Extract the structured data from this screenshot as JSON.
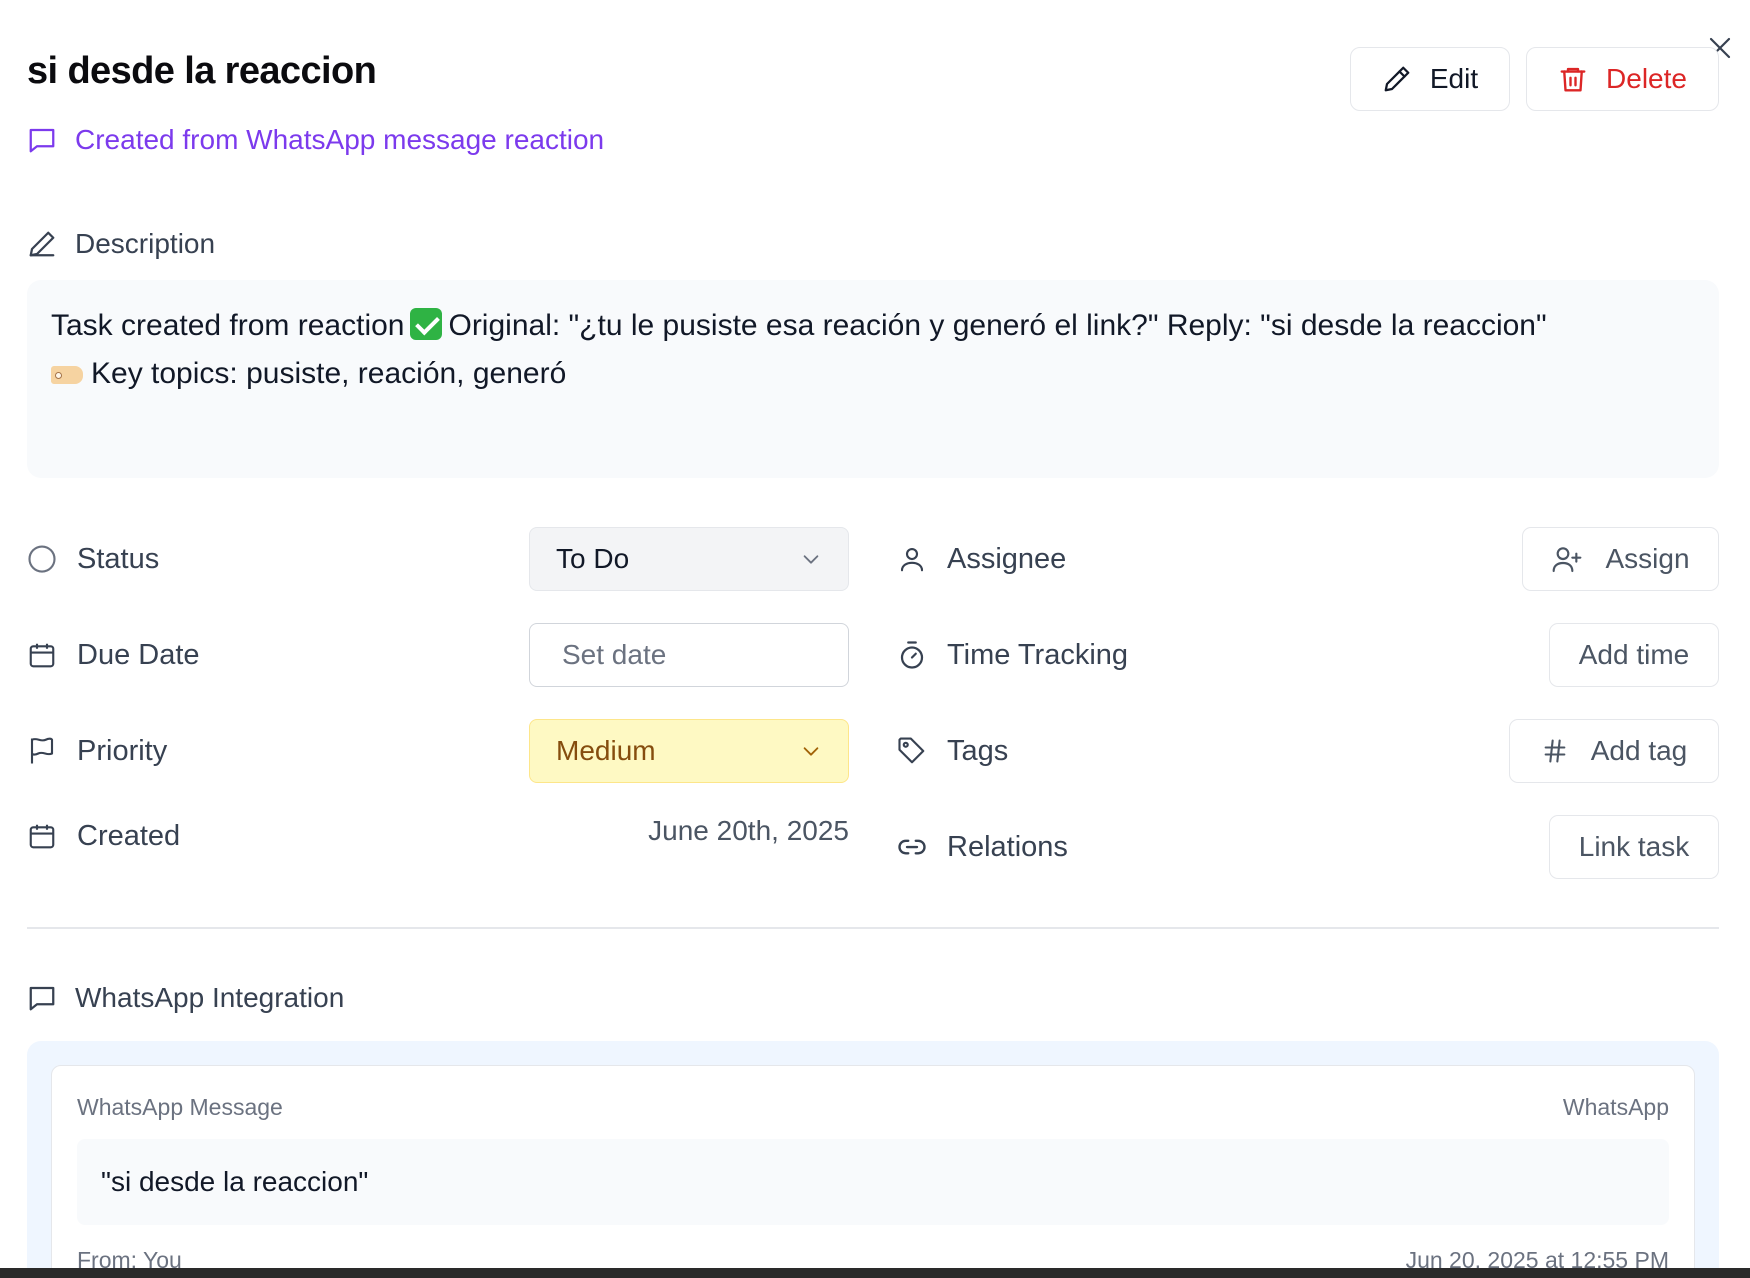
{
  "task": {
    "title": "si desde la reaccion",
    "source": "Created from WhatsApp message reaction"
  },
  "header": {
    "edit_label": "Edit",
    "delete_label": "Delete"
  },
  "description": {
    "label": "Description",
    "line1_before": "Task created from reaction",
    "line1_after": "Original: \"¿tu le pusiste esa reación y generó el link?\" Reply: \"si desde la reaccion\"",
    "line2": "Key topics: pusiste, reación, generó"
  },
  "fields": {
    "status": {
      "label": "Status",
      "value": "To Do"
    },
    "due_date": {
      "label": "Due Date",
      "placeholder": "Set date"
    },
    "priority": {
      "label": "Priority",
      "value": "Medium"
    },
    "created": {
      "label": "Created",
      "value": "June 20th, 2025"
    },
    "assignee": {
      "label": "Assignee",
      "button": "Assign"
    },
    "time_tracking": {
      "label": "Time Tracking",
      "button": "Add time"
    },
    "tags": {
      "label": "Tags",
      "button": "Add tag"
    },
    "relations": {
      "label": "Relations",
      "button": "Link task"
    }
  },
  "whatsapp": {
    "section_label": "WhatsApp Integration",
    "card_title": "WhatsApp Message",
    "badge": "WhatsApp",
    "message": "\"si desde la reaccion\"",
    "from": "From: You",
    "timestamp": "Jun 20, 2025 at 12:55 PM"
  },
  "colors": {
    "accent_purple": "#7c3aed",
    "danger": "#dc2626",
    "priority_bg": "#fef9c3",
    "priority_text": "#854d0e"
  },
  "icons": {
    "close": "close-icon",
    "edit": "pencil-icon",
    "delete": "trash-icon",
    "message": "message-square-icon",
    "status": "circle-icon",
    "calendar": "calendar-icon",
    "flag": "flag-icon",
    "user": "user-icon",
    "user_plus": "user-plus-icon",
    "timer": "timer-icon",
    "tag": "tag-icon",
    "hash": "hash-icon",
    "link": "link-icon",
    "chevron": "chevron-down-icon"
  }
}
